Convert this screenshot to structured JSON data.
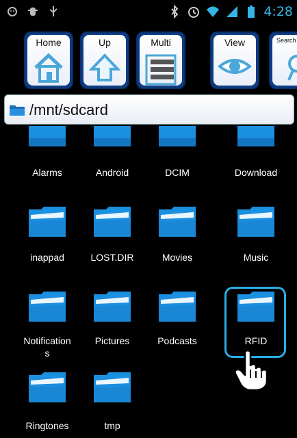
{
  "status_bar": {
    "time": "4:28",
    "left_icons": [
      "android-icon",
      "debug-icon",
      "usb-icon"
    ],
    "right_icons": [
      "bluetooth-icon",
      "alarm-icon",
      "wifi-icon",
      "signal-icon",
      "battery-icon"
    ]
  },
  "toolbar": {
    "buttons": [
      {
        "label": "Home",
        "icon": "home-icon"
      },
      {
        "label": "Up",
        "icon": "up-arrow-icon"
      },
      {
        "label": "Multi",
        "icon": "multi-select-icon"
      },
      {
        "label": "View",
        "icon": "eye-icon"
      },
      {
        "label": "Search",
        "icon": "search-icon"
      }
    ]
  },
  "path": {
    "current": "/mnt/sdcard"
  },
  "folders": [
    {
      "name": "Alarms"
    },
    {
      "name": "Android"
    },
    {
      "name": "DCIM"
    },
    {
      "name": "Download"
    },
    {
      "name": "inappad"
    },
    {
      "name": "LOST.DIR"
    },
    {
      "name": "Movies"
    },
    {
      "name": "Music"
    },
    {
      "name": "Notification",
      "name_wrap": "s"
    },
    {
      "name": "Pictures"
    },
    {
      "name": "Podcasts"
    },
    {
      "name": "RFID"
    },
    {
      "name": "Ringtones"
    },
    {
      "name": "tmp"
    }
  ],
  "selected_folder": "RFID",
  "colors": {
    "accent": "#29aee6",
    "folder_blue": "#1b8fe0",
    "toolbar_blue": "#0d3c83",
    "status_blue": "#33b5e5"
  }
}
